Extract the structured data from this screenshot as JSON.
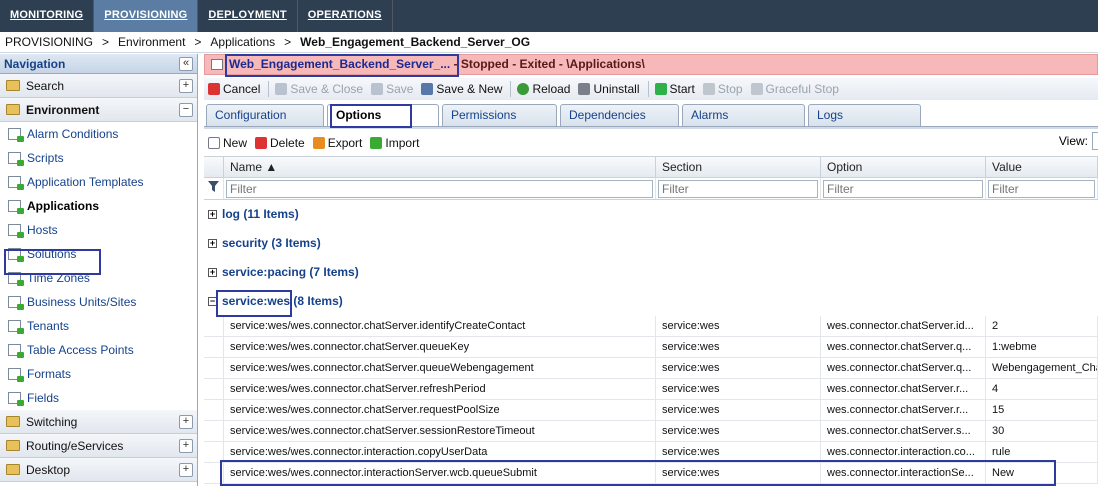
{
  "topnav": {
    "tabs": [
      "MONITORING",
      "PROVISIONING",
      "DEPLOYMENT",
      "OPERATIONS"
    ],
    "active": 1
  },
  "breadcrumb": {
    "items": [
      "PROVISIONING",
      "Environment",
      "Applications"
    ],
    "separator": ">",
    "current": "Web_Engagement_Backend_Server_OG"
  },
  "navigation": {
    "title": "Navigation",
    "collapse_glyph": "«",
    "search": "Search",
    "environment": "Environment",
    "items": [
      "Alarm Conditions",
      "Scripts",
      "Application Templates",
      "Applications",
      "Hosts",
      "Solutions",
      "Time Zones",
      "Business Units/Sites",
      "Tenants",
      "Table Access Points",
      "Formats",
      "Fields"
    ],
    "selected_item": "Applications",
    "bottom_sections": [
      "Switching",
      "Routing/eServices",
      "Desktop"
    ],
    "plus": "+",
    "minus": "−"
  },
  "titlebar": {
    "name": "Web_Engagement_Backend_Server_...",
    "status": " - Stopped - Exited - \\Applications\\",
    "color": "#f6b8b8"
  },
  "toolbar": {
    "cancel": "Cancel",
    "save_close": "Save & Close",
    "save": "Save",
    "save_new": "Save & New",
    "reload": "Reload",
    "uninstall": "Uninstall",
    "start": "Start",
    "stop": "Stop",
    "graceful_stop": "Graceful Stop"
  },
  "tabs": [
    "Configuration",
    "Options",
    "Permissions",
    "Dependencies",
    "Alarms",
    "Logs"
  ],
  "active_tab": "Options",
  "subtoolbar": {
    "new": "New",
    "delete": "Delete",
    "export": "Export",
    "import": "Import",
    "view_label": "View:"
  },
  "grid": {
    "columns": [
      "Name ▲",
      "Section",
      "Option",
      "Value"
    ],
    "filter_placeholder": "Filter",
    "groups": [
      {
        "label": "log (11 Items)",
        "expanded": false
      },
      {
        "label": "security (3 Items)",
        "expanded": false
      },
      {
        "label": "service:pacing (7 Items)",
        "expanded": false
      },
      {
        "label": "service:wes",
        "count_label": " (8 Items)",
        "expanded": true
      }
    ],
    "rows": [
      {
        "name": "service:wes/wes.connector.chatServer.identifyCreateContact",
        "section": "service:wes",
        "option": "wes.connector.chatServer.id...",
        "value": "2"
      },
      {
        "name": "service:wes/wes.connector.chatServer.queueKey",
        "section": "service:wes",
        "option": "wes.connector.chatServer.q...",
        "value": "1:webme"
      },
      {
        "name": "service:wes/wes.connector.chatServer.queueWebengagement",
        "section": "service:wes",
        "option": "wes.connector.chatServer.q...",
        "value": "Webengagement_Chat"
      },
      {
        "name": "service:wes/wes.connector.chatServer.refreshPeriod",
        "section": "service:wes",
        "option": "wes.connector.chatServer.r...",
        "value": "4"
      },
      {
        "name": "service:wes/wes.connector.chatServer.requestPoolSize",
        "section": "service:wes",
        "option": "wes.connector.chatServer.r...",
        "value": "15"
      },
      {
        "name": "service:wes/wes.connector.chatServer.sessionRestoreTimeout",
        "section": "service:wes",
        "option": "wes.connector.chatServer.s...",
        "value": "30"
      },
      {
        "name": "service:wes/wes.connector.interaction.copyUserData",
        "section": "service:wes",
        "option": "wes.connector.interaction.co...",
        "value": "rule"
      },
      {
        "name": "service:wes/wes.connector.interactionServer.wcb.queueSubmit",
        "section": "service:wes",
        "option": "wes.connector.interactionSe...",
        "value": "New"
      }
    ]
  }
}
